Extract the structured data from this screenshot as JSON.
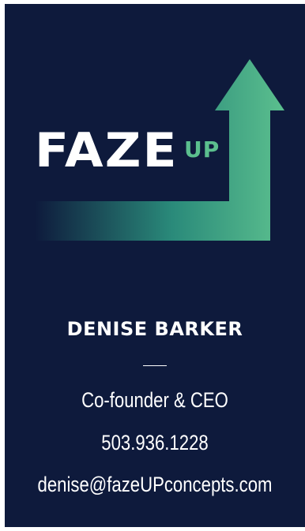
{
  "logo": {
    "word": "FAZE",
    "accent": "UP",
    "colors": {
      "arrow_start": "#0e1a3c",
      "arrow_mid": "#2a8a7a",
      "arrow_end": "#5bbf8e"
    }
  },
  "contact": {
    "name": "DENISE BARKER",
    "title": "Co-founder & CEO",
    "phone": "503.936.1228",
    "email": "denise@fazeUPconcepts.com"
  },
  "colors": {
    "background": "#0e1a3c",
    "text": "#ffffff",
    "accent": "#5bbf8e"
  }
}
